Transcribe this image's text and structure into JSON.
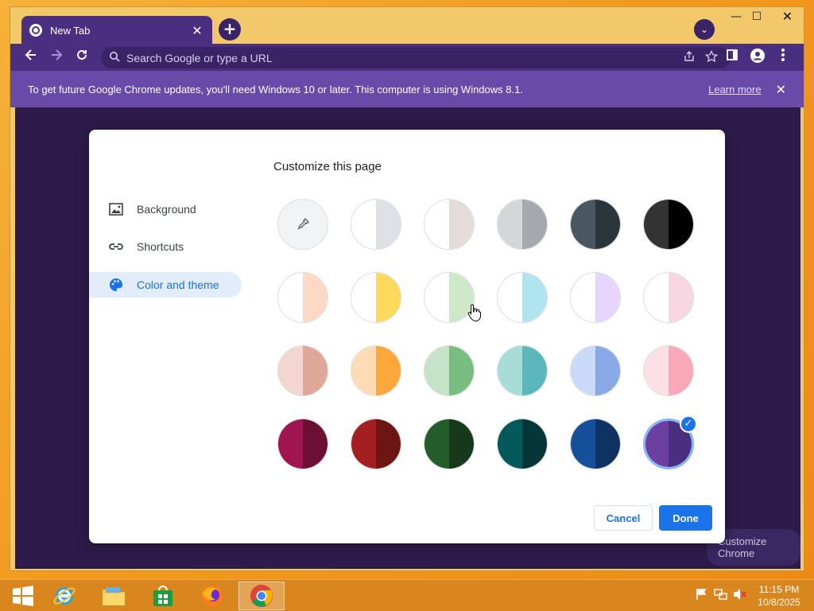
{
  "browser": {
    "tab": {
      "title": "New Tab",
      "close": "✕"
    },
    "new_tab_icon": "+",
    "tab_search_icon": "⌄",
    "window_controls": {
      "minimize": "—",
      "maximize": "☐",
      "close": "✕"
    },
    "omnibox": {
      "placeholder": "Search Google or type a URL"
    },
    "infobar": {
      "text": "To get future Google Chrome updates, you'll need Windows 10 or later. This computer is using Windows 8.1.",
      "link": "Learn more",
      "close": "✕"
    },
    "customize_chrome_label": "Customize Chrome"
  },
  "dialog": {
    "title": "Customize this page",
    "nav": [
      {
        "label": "Background",
        "icon": "image-icon",
        "active": false
      },
      {
        "label": "Shortcuts",
        "icon": "link-icon",
        "active": false
      },
      {
        "label": "Color and theme",
        "icon": "palette-icon",
        "active": true
      }
    ],
    "swatches": [
      {
        "left": "#f1f3f4",
        "right": "#f1f3f4",
        "picker": true
      },
      {
        "left": "#ffffff",
        "right": "#dee1e6"
      },
      {
        "left": "#ffffff",
        "right": "#e3dcd8"
      },
      {
        "left": "#d5d6da",
        "right": "#a5a8af"
      },
      {
        "left": "#4a5762",
        "right": "#2b353c"
      },
      {
        "left": "#333333",
        "right": "#000000"
      },
      {
        "left": "#ffffff",
        "right": "#fbd9c4"
      },
      {
        "left": "#ffffff",
        "right": "#fdd95c"
      },
      {
        "left": "#ffffff",
        "right": "#cde9c7"
      },
      {
        "left": "#ffffff",
        "right": "#b0e4ef"
      },
      {
        "left": "#ffffff",
        "right": "#e7d6fb"
      },
      {
        "left": "#ffffff",
        "right": "#f8d7e3"
      },
      {
        "left": "#f2d6cf",
        "right": "#e0a898"
      },
      {
        "left": "#fddcb5",
        "right": "#fba73a"
      },
      {
        "left": "#c4e3c7",
        "right": "#7abd80"
      },
      {
        "left": "#a8dcd9",
        "right": "#5ab8bb"
      },
      {
        "left": "#c9daf8",
        "right": "#88a9e5"
      },
      {
        "left": "#fde0e6",
        "right": "#f8a8b8"
      },
      {
        "left": "#a0144f",
        "right": "#6b0f33"
      },
      {
        "left": "#a31f22",
        "right": "#6c1512"
      },
      {
        "left": "#245c2a",
        "right": "#17381b"
      },
      {
        "left": "#05595a",
        "right": "#043537"
      },
      {
        "left": "#17509a",
        "right": "#0e3363"
      },
      {
        "left": "#6b3fa0",
        "right": "#4a2f80",
        "selected": true
      }
    ],
    "buttons": {
      "cancel": "Cancel",
      "done": "Done"
    }
  },
  "taskbar": {
    "apps": [
      {
        "name": "start-button",
        "icon": "windows-logo-icon"
      },
      {
        "name": "internet-explorer",
        "icon": "ie-icon"
      },
      {
        "name": "file-explorer",
        "icon": "folder-icon"
      },
      {
        "name": "store",
        "icon": "store-icon"
      },
      {
        "name": "firefox",
        "icon": "firefox-icon"
      },
      {
        "name": "chrome",
        "icon": "chrome-icon",
        "active": true
      }
    ],
    "clock": {
      "time": "11:15 PM",
      "date": "10/8/2025"
    }
  }
}
